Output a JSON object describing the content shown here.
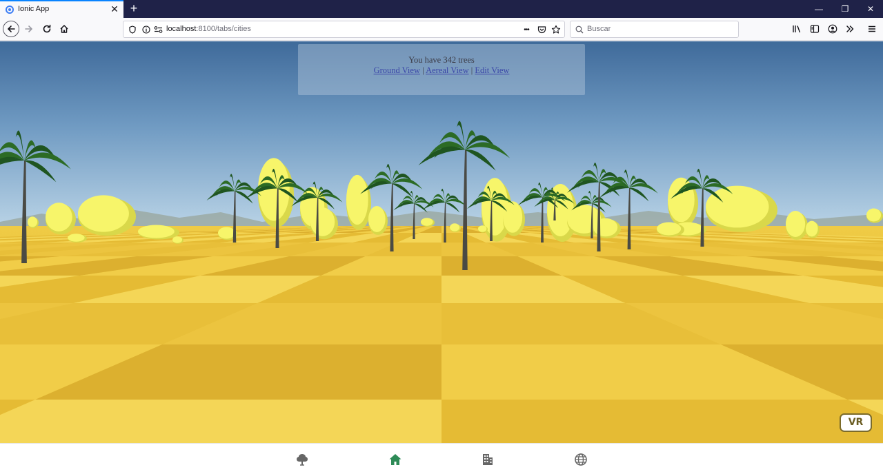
{
  "browser": {
    "tab_title": "Ionic App",
    "tab_close_glyph": "✕",
    "new_tab_glyph": "+",
    "url_host": "localhost",
    "url_rest": ":8100/tabs/cities",
    "search_placeholder": "Buscar",
    "page_actions_glyph": "•••",
    "window_controls": {
      "minimize": "—",
      "restore": "❐",
      "close": "✕"
    }
  },
  "overlay": {
    "tree_count_text": "You have 342 trees",
    "links": {
      "ground": "Ground View",
      "aereal": "Aereal View",
      "edit": "Edit View",
      "separator": "|"
    }
  },
  "vr_button": {
    "label": "VR"
  },
  "tabbar": {
    "active_tab": "home",
    "active_color": "#2e8b57",
    "inactive_color": "#666666",
    "tabs": [
      {
        "id": "trees",
        "icon": "tree-icon"
      },
      {
        "id": "home",
        "icon": "home-icon"
      },
      {
        "id": "cities",
        "icon": "building-icon"
      },
      {
        "id": "world",
        "icon": "globe-icon"
      }
    ]
  },
  "colors": {
    "sky_top": "#3f6a9a",
    "sky_bottom": "#9cc0da",
    "ground": "#e8c23d",
    "tree_foliage": "#f7f56a",
    "palm_leaf": "#2c6b25",
    "palm_trunk": "#4a4a44"
  }
}
